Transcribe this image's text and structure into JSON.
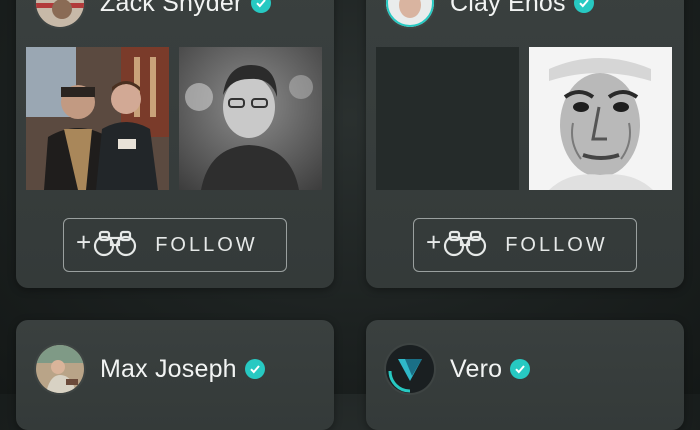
{
  "cards": [
    {
      "name": "Zack Snyder",
      "follow_label": "FOLLOW",
      "verified": true
    },
    {
      "name": "Clay Enos",
      "follow_label": "FOLLOW",
      "verified": true
    },
    {
      "name": "Max Joseph",
      "verified": true
    },
    {
      "name": "Vero",
      "verified": true
    }
  ],
  "colors": {
    "accent": "#27c9c2",
    "card": "#383e3d",
    "background": "#1c2120"
  },
  "icons": {
    "verified": "check-badge-icon",
    "follow": "binoculars-icon",
    "add": "plus-icon"
  }
}
